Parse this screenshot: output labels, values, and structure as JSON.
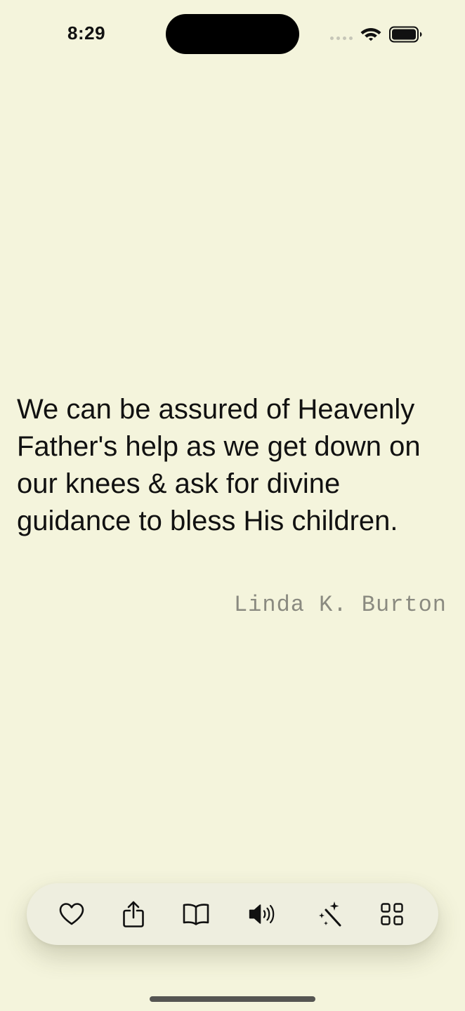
{
  "status_bar": {
    "time": "8:29",
    "icons": [
      "cellular-signal-icon",
      "wifi-icon",
      "battery-icon"
    ]
  },
  "quote": {
    "text": "We can be assured of Heavenly Father's help as we get down on our knees & ask for divine guidance to bless His children.",
    "author": "Linda K. Burton"
  },
  "toolbar": {
    "buttons": [
      {
        "name": "favorite",
        "icon": "heart-icon"
      },
      {
        "name": "share",
        "icon": "share-icon"
      },
      {
        "name": "read",
        "icon": "book-icon"
      },
      {
        "name": "audio",
        "icon": "speaker-icon"
      },
      {
        "name": "theme",
        "icon": "magic-wand-icon"
      },
      {
        "name": "categories",
        "icon": "grid-icon"
      }
    ]
  },
  "colors": {
    "background": "#f4f4dc",
    "toolbar": "#eeeedf",
    "text": "#111111",
    "author": "#8a8a80"
  }
}
